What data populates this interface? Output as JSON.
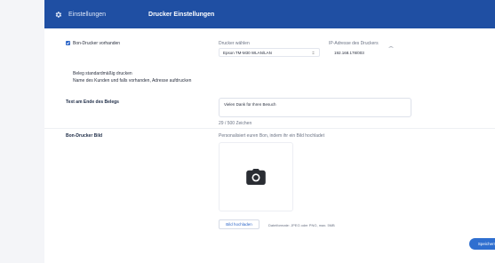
{
  "header": {
    "icon": "gear-icon",
    "title": "Einstellungen",
    "subtitle": "Drucker Einstellungen",
    "background": "#1f4fa3"
  },
  "form": {
    "bon_printer_checkbox": {
      "label": "Bon-Drucker vorhanden",
      "checked": true
    },
    "printer_select": {
      "label": "Drucker wählen",
      "value": "Epson TM-M30 WLAN/LAN"
    },
    "ip_field": {
      "label": "IP-Adresse des Druckers",
      "value": "192.168.178/003"
    },
    "print_default": {
      "line1": "Beleg standardmäßig drucken",
      "line2": "Name des Kunden und falls vorhanden, Adresse aufdrucken"
    },
    "footer_text": {
      "label": "Text am Ende des Belegs",
      "value": "Vielen Dank für Ihren Besuch",
      "counter": "29 / 500 Zeichen"
    },
    "bon_image": {
      "label": "Bon-Drucker Bild",
      "hint": "Personalisiert euren Bon, indem ihr ein Bild hochladet",
      "icon": "camera-icon",
      "upload_button": "Bild hochladen",
      "formats": "Dateiformate: JPEG oder PNG, max. 5MB"
    }
  },
  "actions": {
    "save": "Speichern"
  },
  "accent": "#2d66c8"
}
